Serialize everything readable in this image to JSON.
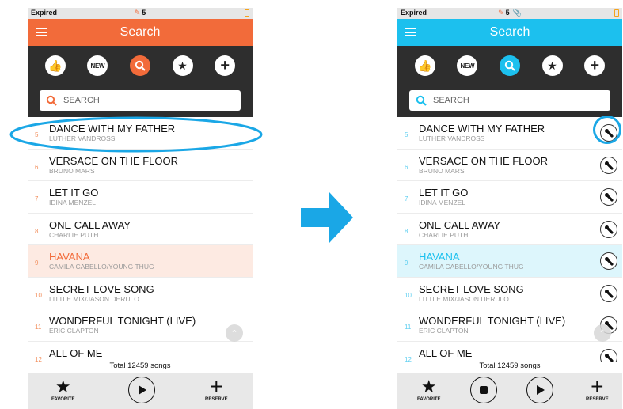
{
  "status": {
    "carrier": "Expired",
    "count": "5"
  },
  "header": {
    "title": "Search"
  },
  "nav": {
    "new_label": "NEW"
  },
  "search": {
    "placeholder": "SEARCH"
  },
  "songs": [
    {
      "num": "5",
      "title": "DANCE WITH MY FATHER",
      "artist": "LUTHER VANDROSS",
      "highlighted": false
    },
    {
      "num": "6",
      "title": "VERSACE ON THE FLOOR",
      "artist": "BRUNO MARS",
      "highlighted": false
    },
    {
      "num": "7",
      "title": "LET IT GO",
      "artist": "IDINA MENZEL",
      "highlighted": false
    },
    {
      "num": "8",
      "title": "ONE CALL AWAY",
      "artist": "CHARLIE PUTH",
      "highlighted": false
    },
    {
      "num": "9",
      "title": "HAVANA",
      "artist": "CAMILA CABELLO/YOUNG THUG",
      "highlighted": true
    },
    {
      "num": "10",
      "title": "SECRET LOVE SONG",
      "artist": "LITTLE MIX/JASON DERULO",
      "highlighted": false
    },
    {
      "num": "11",
      "title": "WONDERFUL TONIGHT (LIVE)",
      "artist": "ERIC CLAPTON",
      "highlighted": false
    },
    {
      "num": "12",
      "title": "ALL OF ME",
      "artist": "",
      "highlighted": false
    }
  ],
  "footer": {
    "total": "Total 12459 songs",
    "favorite_label": "FAVORITE",
    "reserve_label": "RESERVE"
  },
  "colors": {
    "orange": "#f26b3a",
    "blue": "#1cc0ee",
    "arrow": "#1aa7e6"
  },
  "icons": [
    "menu-icon",
    "thumbs-up-icon",
    "search-icon",
    "star-icon",
    "plus-icon",
    "microphone-icon",
    "play-icon",
    "stop-icon",
    "arrow-right-icon",
    "chevron-up-icon"
  ]
}
